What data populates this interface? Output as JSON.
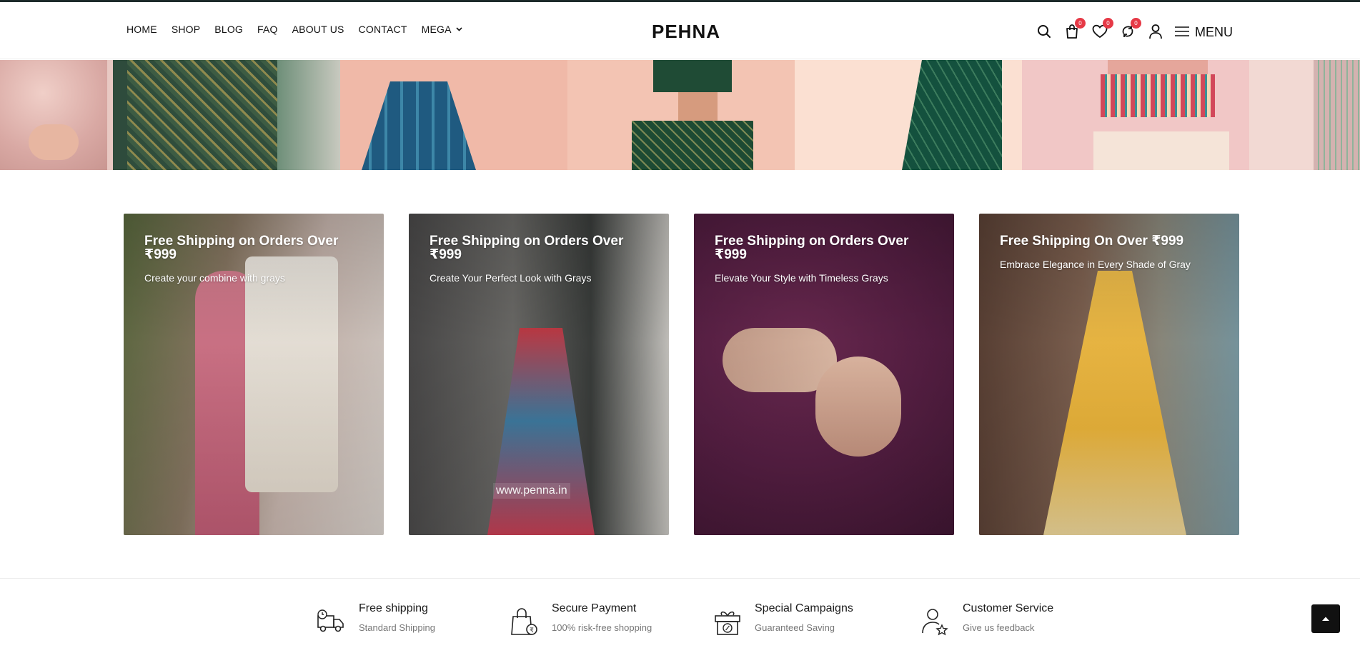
{
  "header": {
    "logo": "PEHNA",
    "nav": [
      {
        "label": "HOME"
      },
      {
        "label": "SHOP"
      },
      {
        "label": "BLOG"
      },
      {
        "label": "FAQ"
      },
      {
        "label": "ABOUT US"
      },
      {
        "label": "CONTACT"
      },
      {
        "label": "MEGA"
      }
    ],
    "cart_count": "0",
    "wishlist_count": "0",
    "compare_count": "0",
    "menu_label": "MENU"
  },
  "promo_cards": [
    {
      "title": "Free Shipping on Orders Over ₹999",
      "subtitle": "Create your combine with grays"
    },
    {
      "title": "Free Shipping on Orders Over ₹999",
      "subtitle": "Create Your Perfect Look with Grays",
      "watermark": "www.penna.in"
    },
    {
      "title": "Free Shipping on Orders Over ₹999",
      "subtitle": "Elevate Your Style with Timeless Grays"
    },
    {
      "title": "Free Shipping On Over ₹999",
      "subtitle": "Embrace Elegance in Every Shade of Gray"
    }
  ],
  "features": [
    {
      "title": "Free shipping",
      "subtitle": "Standard Shipping",
      "icon": "delivery-truck-icon"
    },
    {
      "title": "Secure Payment",
      "subtitle": "100% risk-free shopping",
      "icon": "shopping-bag-rupee-icon"
    },
    {
      "title": "Special Campaigns",
      "subtitle": "Guaranteed Saving",
      "icon": "gift-percent-icon"
    },
    {
      "title": "Customer Service",
      "subtitle": "Give us feedback",
      "icon": "user-star-icon"
    }
  ],
  "colors": {
    "badge": "#e63946",
    "topline": "#1c2a2a",
    "text": "#111111"
  }
}
